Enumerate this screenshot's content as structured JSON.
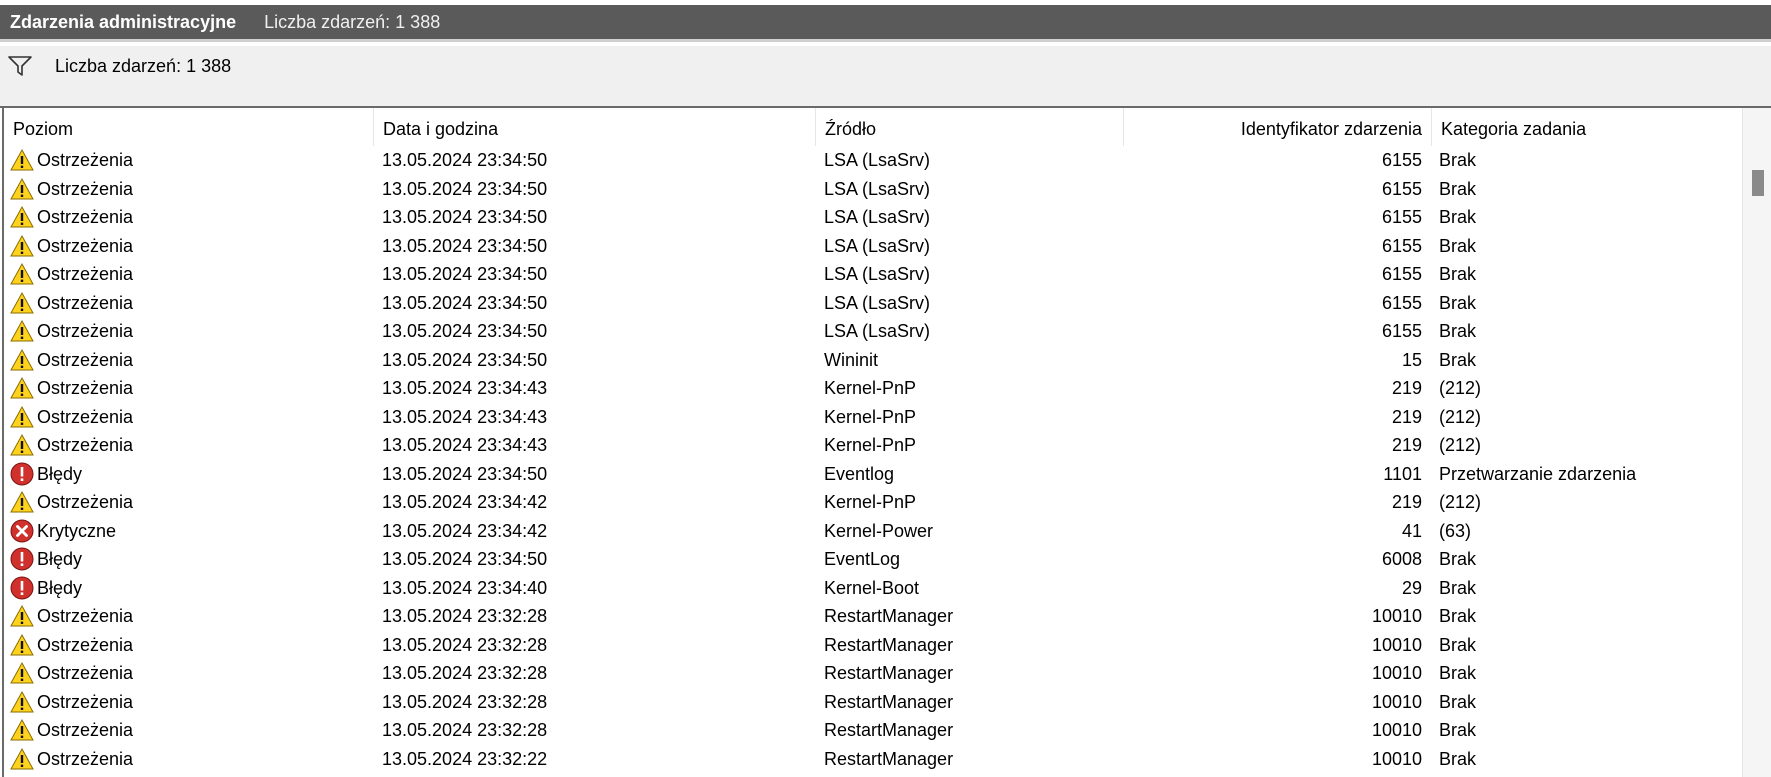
{
  "window": {
    "title": "Zdarzenia administracyjne",
    "count_label": "Liczba zdarzeń: 1 388"
  },
  "filter": {
    "icon": "filter-icon",
    "text": "Liczba zdarzeń: 1 388"
  },
  "columns": [
    {
      "key": "level",
      "label": "Poziom"
    },
    {
      "key": "date",
      "label": "Data i godzina"
    },
    {
      "key": "source",
      "label": "Źródło"
    },
    {
      "key": "eventid",
      "label": "Identyfikator zdarzenia"
    },
    {
      "key": "category",
      "label": "Kategoria zadania"
    }
  ],
  "rows": [
    {
      "level": "Ostrzeżenia",
      "icon": "warning",
      "date": "13.05.2024 23:34:50",
      "source": "LSA (LsaSrv)",
      "eventid": "6155",
      "category": "Brak"
    },
    {
      "level": "Ostrzeżenia",
      "icon": "warning",
      "date": "13.05.2024 23:34:50",
      "source": "LSA (LsaSrv)",
      "eventid": "6155",
      "category": "Brak"
    },
    {
      "level": "Ostrzeżenia",
      "icon": "warning",
      "date": "13.05.2024 23:34:50",
      "source": "LSA (LsaSrv)",
      "eventid": "6155",
      "category": "Brak"
    },
    {
      "level": "Ostrzeżenia",
      "icon": "warning",
      "date": "13.05.2024 23:34:50",
      "source": "LSA (LsaSrv)",
      "eventid": "6155",
      "category": "Brak"
    },
    {
      "level": "Ostrzeżenia",
      "icon": "warning",
      "date": "13.05.2024 23:34:50",
      "source": "LSA (LsaSrv)",
      "eventid": "6155",
      "category": "Brak"
    },
    {
      "level": "Ostrzeżenia",
      "icon": "warning",
      "date": "13.05.2024 23:34:50",
      "source": "LSA (LsaSrv)",
      "eventid": "6155",
      "category": "Brak"
    },
    {
      "level": "Ostrzeżenia",
      "icon": "warning",
      "date": "13.05.2024 23:34:50",
      "source": "LSA (LsaSrv)",
      "eventid": "6155",
      "category": "Brak"
    },
    {
      "level": "Ostrzeżenia",
      "icon": "warning",
      "date": "13.05.2024 23:34:50",
      "source": "Wininit",
      "eventid": "15",
      "category": "Brak"
    },
    {
      "level": "Ostrzeżenia",
      "icon": "warning",
      "date": "13.05.2024 23:34:43",
      "source": "Kernel-PnP",
      "eventid": "219",
      "category": "(212)"
    },
    {
      "level": "Ostrzeżenia",
      "icon": "warning",
      "date": "13.05.2024 23:34:43",
      "source": "Kernel-PnP",
      "eventid": "219",
      "category": "(212)"
    },
    {
      "level": "Ostrzeżenia",
      "icon": "warning",
      "date": "13.05.2024 23:34:43",
      "source": "Kernel-PnP",
      "eventid": "219",
      "category": "(212)"
    },
    {
      "level": "Błędy",
      "icon": "error",
      "date": "13.05.2024 23:34:50",
      "source": "Eventlog",
      "eventid": "1101",
      "category": "Przetwarzanie zdarzenia"
    },
    {
      "level": "Ostrzeżenia",
      "icon": "warning",
      "date": "13.05.2024 23:34:42",
      "source": "Kernel-PnP",
      "eventid": "219",
      "category": "(212)"
    },
    {
      "level": "Krytyczne",
      "icon": "critical",
      "date": "13.05.2024 23:34:42",
      "source": "Kernel-Power",
      "eventid": "41",
      "category": "(63)"
    },
    {
      "level": "Błędy",
      "icon": "error",
      "date": "13.05.2024 23:34:50",
      "source": "EventLog",
      "eventid": "6008",
      "category": "Brak"
    },
    {
      "level": "Błędy",
      "icon": "error",
      "date": "13.05.2024 23:34:40",
      "source": "Kernel-Boot",
      "eventid": "29",
      "category": "Brak"
    },
    {
      "level": "Ostrzeżenia",
      "icon": "warning",
      "date": "13.05.2024 23:32:28",
      "source": "RestartManager",
      "eventid": "10010",
      "category": "Brak"
    },
    {
      "level": "Ostrzeżenia",
      "icon": "warning",
      "date": "13.05.2024 23:32:28",
      "source": "RestartManager",
      "eventid": "10010",
      "category": "Brak"
    },
    {
      "level": "Ostrzeżenia",
      "icon": "warning",
      "date": "13.05.2024 23:32:28",
      "source": "RestartManager",
      "eventid": "10010",
      "category": "Brak"
    },
    {
      "level": "Ostrzeżenia",
      "icon": "warning",
      "date": "13.05.2024 23:32:28",
      "source": "RestartManager",
      "eventid": "10010",
      "category": "Brak"
    },
    {
      "level": "Ostrzeżenia",
      "icon": "warning",
      "date": "13.05.2024 23:32:28",
      "source": "RestartManager",
      "eventid": "10010",
      "category": "Brak"
    },
    {
      "level": "Ostrzeżenia",
      "icon": "warning",
      "date": "13.05.2024 23:32:22",
      "source": "RestartManager",
      "eventid": "10010",
      "category": "Brak"
    }
  ],
  "colors": {
    "title_bar": "#5a5a5a",
    "warning": "#ffd21e",
    "error": "#d0312d",
    "critical": "#d0312d"
  }
}
